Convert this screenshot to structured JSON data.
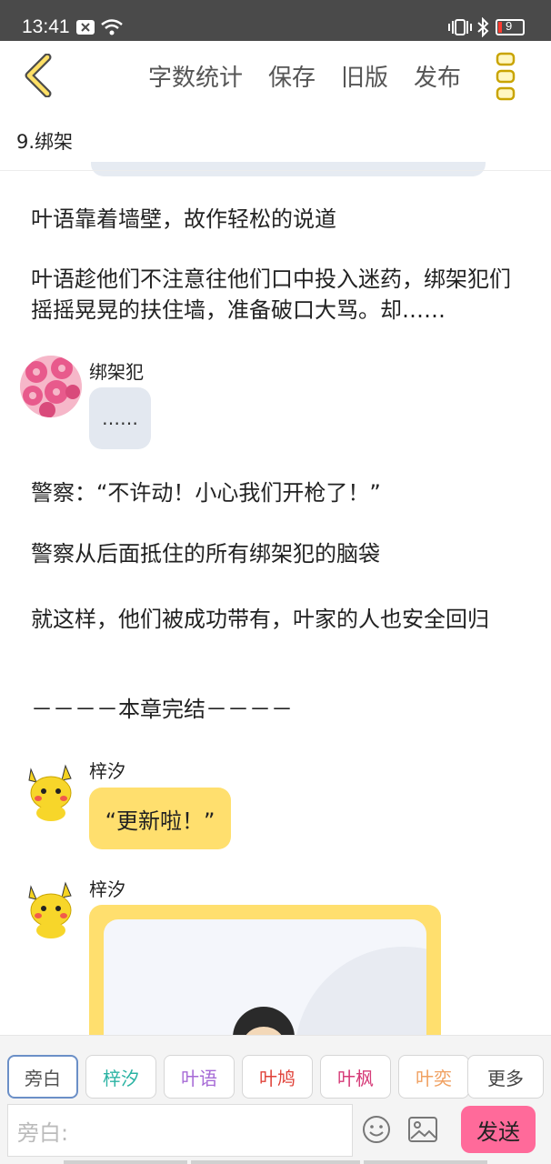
{
  "status_bar": {
    "time": "13:41",
    "battery": "9"
  },
  "toolbar": {
    "back_icon": "chevron-left-icon",
    "menu": [
      "字数统计",
      "保存",
      "旧版",
      "发布"
    ],
    "more_icon": "kebab-menu-icon"
  },
  "chapter_title": "9.绑架",
  "story": {
    "narration": [
      "叶语靠着墙壁，故作轻松的说道",
      "叶语趁他们不注意往他们口中投入迷药，绑架犯们摇摇晃晃的扶住墙，准备破口大骂。却……"
    ],
    "dialog_1": {
      "speaker": "绑架犯",
      "text": "……",
      "bubble_color": "#e3e8f0"
    },
    "narration_after": [
      "警察：“不许动！小心我们开枪了！”",
      "警察从后面抵住的所有绑架犯的脑袋",
      "就这样，他们被成功带有，叶家的人也安全回归",
      "－－－－本章完结－－－－"
    ],
    "dialog_2": {
      "speaker": "梓汐",
      "text": "“更新啦！”",
      "bubble_color": "#ffdf6e"
    },
    "dialog_3": {
      "speaker": "梓汐",
      "card_color": "#ffdf6e"
    }
  },
  "roles": [
    {
      "label": "旁白",
      "color": "#555555"
    },
    {
      "label": "梓汐",
      "color": "#2bb3a3"
    },
    {
      "label": "叶语",
      "color": "#a66ad6"
    },
    {
      "label": "叶鸠",
      "color": "#e0433a"
    },
    {
      "label": "叶枫",
      "color": "#d63b78"
    },
    {
      "label": "叶奕",
      "color": "#f0a060"
    },
    {
      "label": "更多",
      "color": "#444444"
    }
  ],
  "input": {
    "placeholder": "旁白:"
  },
  "emoji_icon": "smiley-icon",
  "image_icon": "image-icon",
  "send_label": "发送"
}
